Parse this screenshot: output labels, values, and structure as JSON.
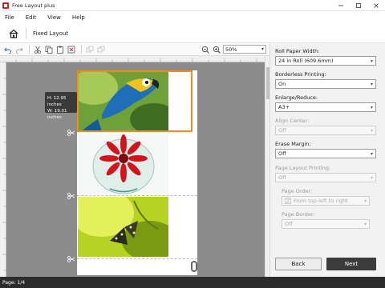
{
  "window": {
    "title": "Free Layout plus"
  },
  "menu": {
    "items": [
      "File",
      "Edit",
      "View",
      "Help"
    ]
  },
  "nav": {
    "title": "Fixed Layout"
  },
  "toolbar": {
    "zoom": "50%"
  },
  "canvas": {
    "tooltip": {
      "height": "H: 12.95 inches",
      "width": "W: 19.01 inches"
    }
  },
  "panel": {
    "roll_paper_width": {
      "label": "Roll Paper Width:",
      "value": "24 in Roll (609.6mm)"
    },
    "borderless": {
      "label": "Borderless Printing:",
      "value": "On"
    },
    "enlarge": {
      "label": "Enlarge/Reduce:",
      "value": "A3+"
    },
    "align_center": {
      "label": "Align Center:",
      "value": "Off"
    },
    "erase_margin": {
      "label": "Erase Margin:",
      "value": "Off"
    },
    "page_layout": {
      "label": "Page Layout Printing:",
      "value": "Off"
    },
    "page_order": {
      "label": "Page Order:",
      "value": "From top-left to right"
    },
    "page_border": {
      "label": "Page Border:",
      "value": "Off"
    },
    "back_label": "Back",
    "next_label": "Next"
  },
  "status": {
    "page": "Page: 1/4"
  },
  "colors": {
    "selection": "#f08a24",
    "next_button": "#3c3c3c",
    "canvas_bg": "#8c8c8c"
  }
}
